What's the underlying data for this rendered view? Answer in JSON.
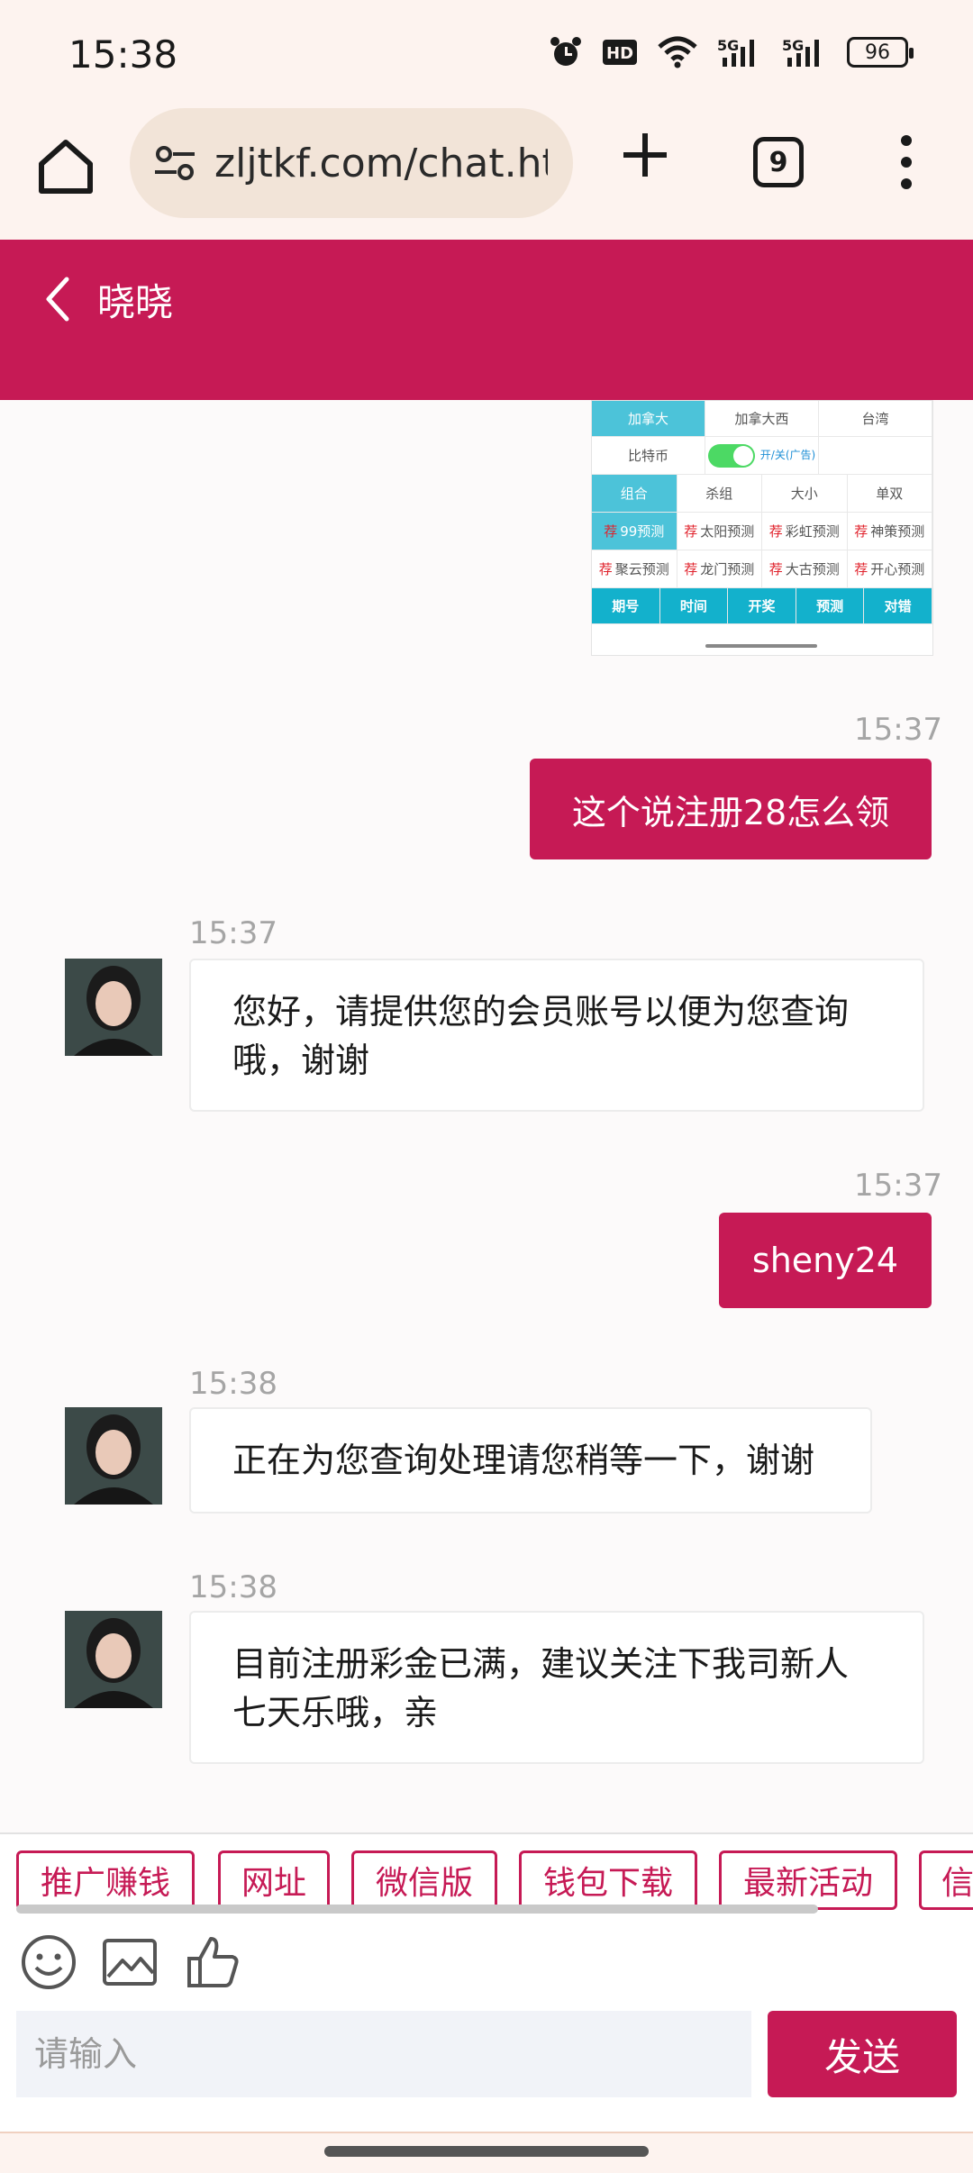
{
  "status_bar": {
    "time": "15:38",
    "icons": [
      "alarm-icon",
      "hd-icon",
      "wifi-icon",
      "5g-signal-icon",
      "5g-signal-icon"
    ],
    "battery": "96"
  },
  "browser": {
    "url": "zljtkf.com/chat.ht",
    "tab_count": "9"
  },
  "chat": {
    "title": "晓晓",
    "messages": [
      {
        "direction": "out",
        "time": "15:37",
        "text": "这个说注册28怎么领"
      },
      {
        "direction": "in",
        "time": "15:37",
        "text": "您好，请提供您的会员账号以便为您查询哦，谢谢"
      },
      {
        "direction": "out",
        "time": "15:37",
        "text": "sheny24"
      },
      {
        "direction": "in",
        "time": "15:38",
        "text": "正在为您查询处理请您稍等一下，谢谢"
      },
      {
        "direction": "in",
        "time": "15:38",
        "text": "目前注册彩金已满，建议关注下我司新人七天乐哦，亲"
      }
    ]
  },
  "embedded_image": {
    "row1": [
      "加拿大",
      "加拿大西",
      "台湾"
    ],
    "row2": {
      "label": "比特币",
      "toggle_label": "开/关(广告)"
    },
    "row3": [
      "组合",
      "杀组",
      "大小",
      "单双"
    ],
    "row4": [
      "99预测",
      "太阳预测",
      "彩虹预测",
      "神策预测"
    ],
    "row5": [
      "聚云预测",
      "龙门预测",
      "大古预测",
      "开心预测"
    ],
    "row6": [
      "期号",
      "时间",
      "开奖",
      "预测",
      "对错"
    ],
    "rec_mark": "荐"
  },
  "quick_replies": [
    "推广赚钱",
    "网址",
    "微信版",
    "钱包下载",
    "最新活动",
    "信"
  ],
  "input": {
    "placeholder": "请输入",
    "send_label": "发送"
  },
  "colors": {
    "accent": "#c61a55",
    "browser_bg": "#fdf3ef",
    "url_bg": "#f2e4d8"
  }
}
